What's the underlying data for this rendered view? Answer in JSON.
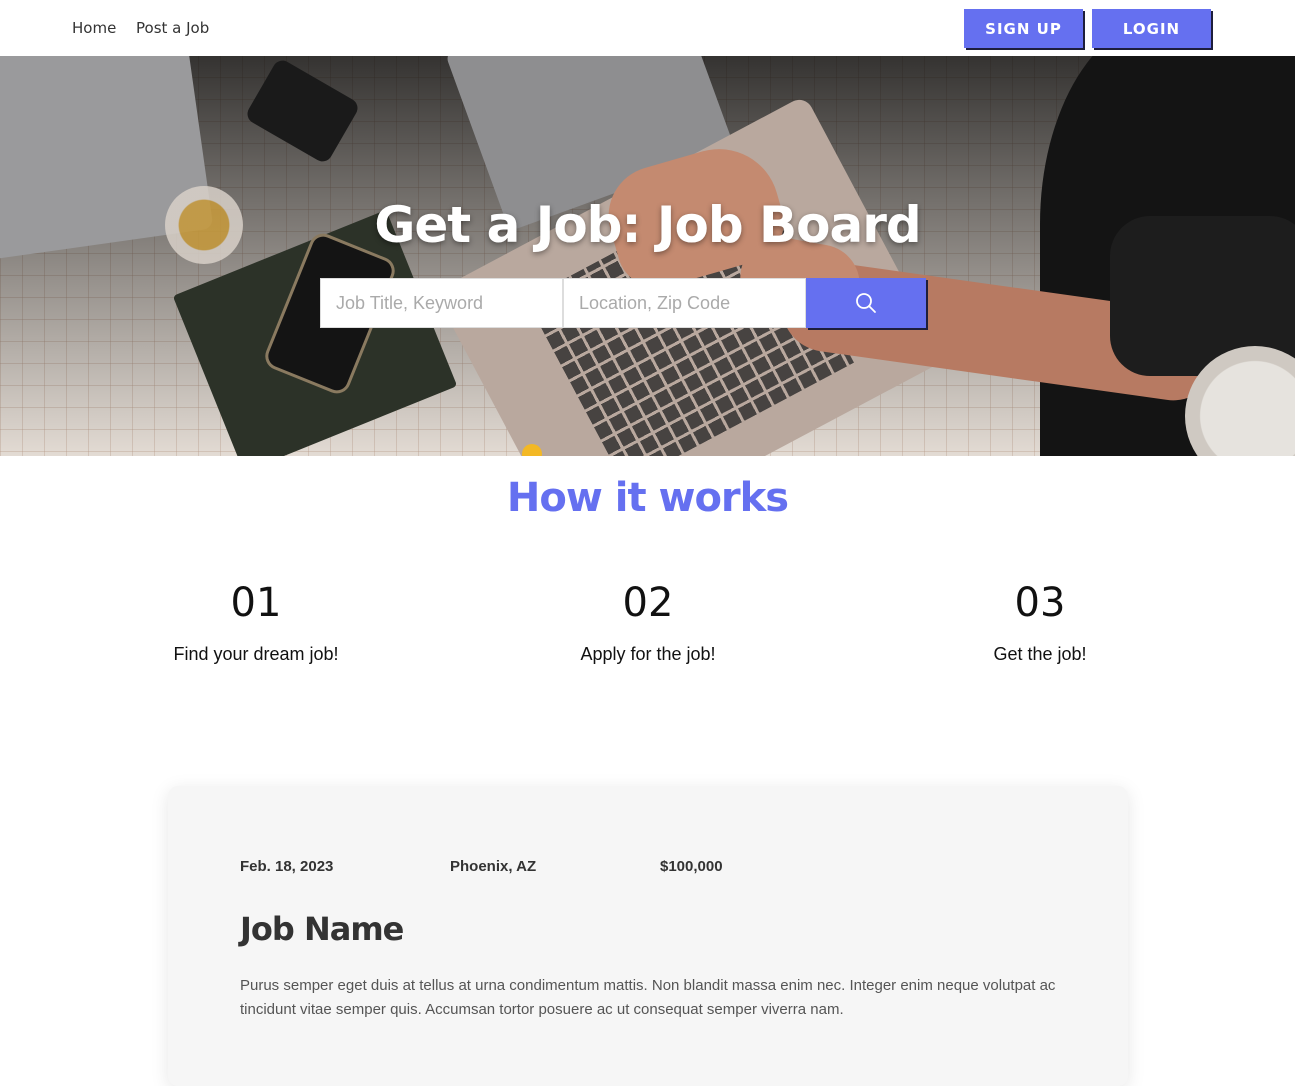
{
  "nav": {
    "links": [
      {
        "label": "Home"
      },
      {
        "label": "Post a Job"
      }
    ],
    "signup_label": "SIGN UP",
    "login_label": "LOGIN"
  },
  "hero": {
    "title": "Get a Job: Job Board",
    "search": {
      "keyword_placeholder": "Job Title, Keyword",
      "location_placeholder": "Location, Zip Code",
      "button_icon": "search-icon"
    }
  },
  "how_it_works": {
    "title": "How it works",
    "steps": [
      {
        "number": "01",
        "text": "Find your dream job!"
      },
      {
        "number": "02",
        "text": "Apply for the job!"
      },
      {
        "number": "03",
        "text": "Get the job!"
      }
    ]
  },
  "job": {
    "date": "Feb. 18, 2023",
    "location": "Phoenix, AZ",
    "salary": "$100,000",
    "name": "Job Name",
    "description": "Purus semper eget duis at tellus at urna condimentum mattis. Non blandit massa enim nec. Integer enim neque volutpat ac tincidunt vitae semper quis. Accumsan tortor posuere ac ut consequat semper viverra nam."
  },
  "colors": {
    "accent": "#6570f0",
    "text": "#333333",
    "card_bg": "#f6f6f6"
  }
}
